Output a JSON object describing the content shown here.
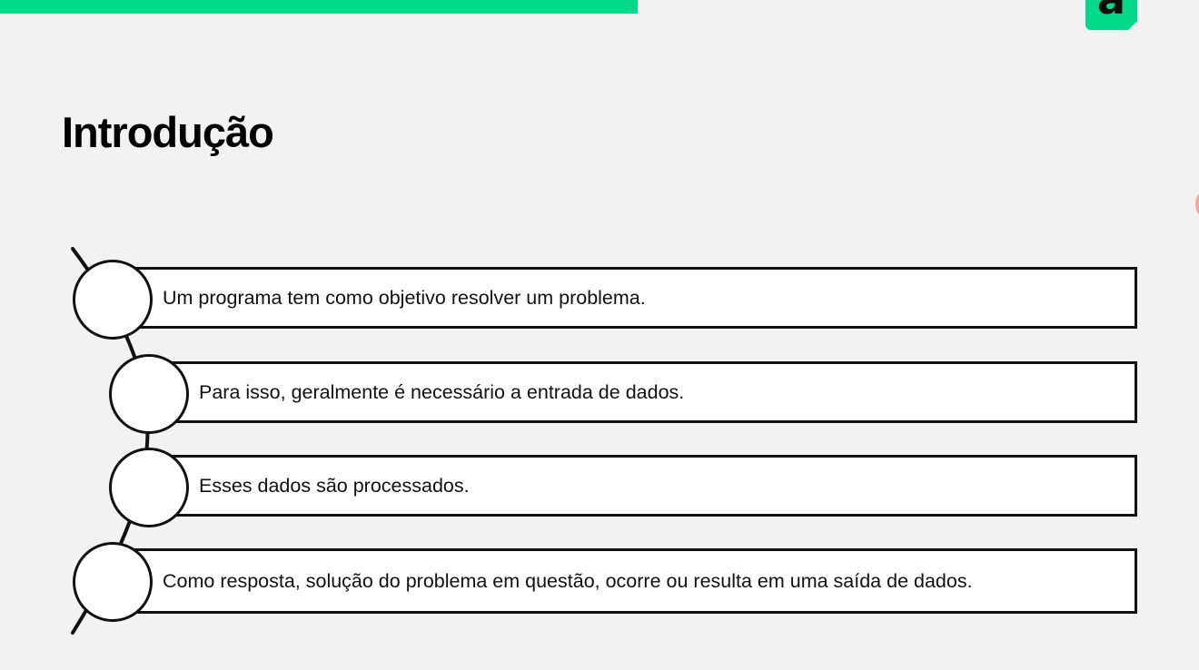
{
  "slide": {
    "title": "Introdução",
    "brand_letter": "a",
    "colors": {
      "accent": "#00d88a",
      "background": "#f2f2f2",
      "box_fill": "#ffffff",
      "border": "#111111",
      "edge_mark": "#f7a79a"
    }
  },
  "steps": [
    {
      "text": "Um programa tem como objetivo resolver um problema."
    },
    {
      "text": "Para isso, geralmente é necessário a entrada de dados."
    },
    {
      "text": "Esses dados são processados."
    },
    {
      "text": "Como resposta, solução do problema em questão, ocorre ou resulta em uma saída de dados."
    }
  ]
}
